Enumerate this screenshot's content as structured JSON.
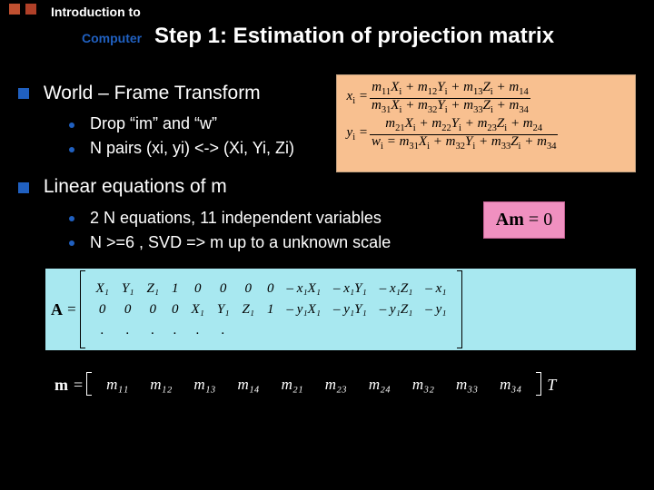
{
  "header": {
    "intro": "Introduction to",
    "sub": "Computer",
    "title": "Step 1:  Estimation of projection matrix"
  },
  "section1": {
    "title": "World – Frame Transform",
    "items": [
      "Drop “im” and “w”",
      "N pairs (xi, yi) <-> (Xi, Yi, Zi)"
    ]
  },
  "section2": {
    "title": "Linear equations of m",
    "items": [
      "2 N equations, 11 independent variables",
      "N >=6 , SVD => m up to a unknown scale"
    ]
  },
  "eq": {
    "x_lhs": "x",
    "y_lhs": "y",
    "x_num_terms": [
      "m",
      "X",
      " + m",
      "Y",
      " + m",
      "Z",
      " + m"
    ],
    "x_num_subs": [
      "11",
      "i",
      "12",
      "i",
      "13",
      "i",
      "14"
    ],
    "y_num_terms": [
      "m",
      "X",
      " + m",
      "Y",
      " + m",
      "Z",
      " + m"
    ],
    "y_num_subs": [
      "21",
      "i",
      "22",
      "i",
      "23",
      "i",
      "24"
    ],
    "den_terms": [
      "m",
      "X",
      " + m",
      "Y",
      " + m",
      "Z",
      " + m"
    ],
    "den_subs": [
      "31",
      "i",
      "32",
      "i",
      "33",
      "i",
      "34"
    ],
    "i_sub": "i",
    "w_lhs": "w",
    "eq_sign": "="
  },
  "am0": {
    "text_pre": "Am",
    "text_post": " = 0",
    "A": "A",
    "m": "m"
  },
  "matrixA": {
    "label": "A",
    "eq": " = ",
    "rows": [
      [
        "X₁",
        "Y₁",
        "Z₁",
        "1",
        "0",
        "0",
        "0",
        "0",
        "– x₁X₁",
        "– x₁Y₁",
        "– x₁Z₁",
        "– x₁"
      ],
      [
        "0",
        "0",
        "0",
        "0",
        "X₁",
        "Y₁",
        "Z₁",
        "1",
        "– y₁X₁",
        "– y₁Y₁",
        "– y₁Z₁",
        "– y₁"
      ],
      [
        ".",
        ".",
        ".",
        ".",
        ".",
        ".",
        "",
        "",
        "",
        "",
        "",
        ""
      ]
    ]
  },
  "vecm": {
    "label": "m",
    "eq": " = ",
    "cells": [
      "m₁₁",
      "m₁₂",
      "m₁₃",
      "m₁₄",
      "m₂₁",
      "m₂₃",
      "m₂₄",
      "m₃₂",
      "m₃₃",
      "m₃₄"
    ],
    "transpose": "T"
  }
}
